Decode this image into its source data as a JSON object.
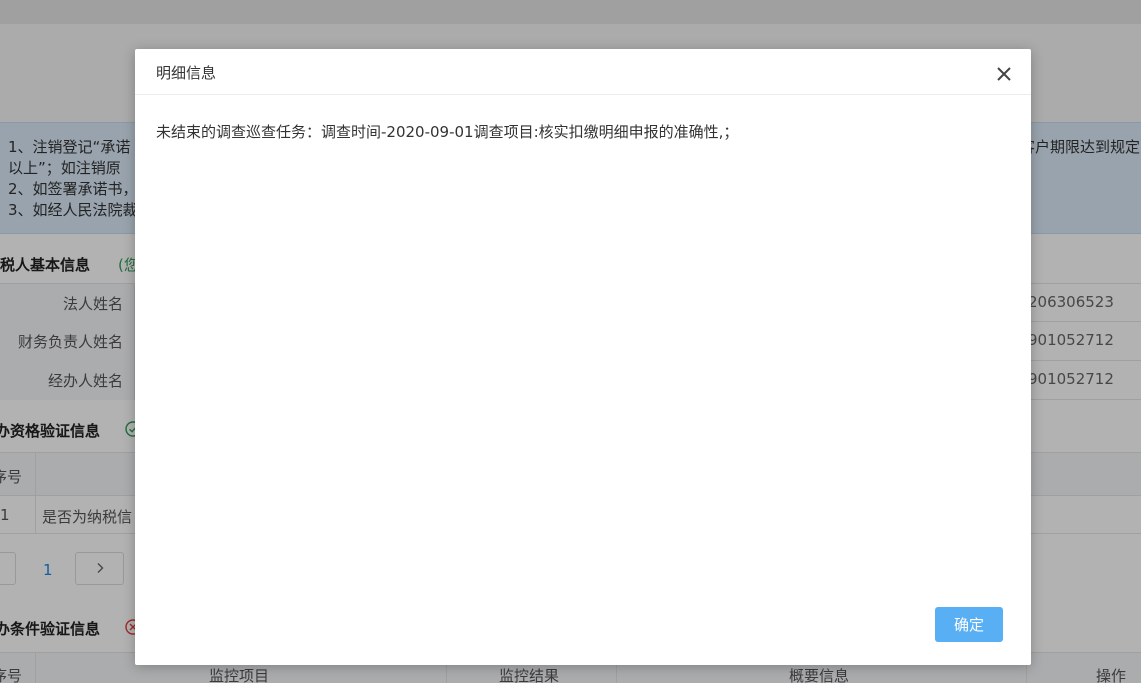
{
  "background": {
    "notice": {
      "line1_left": "1、注销登记“承诺",
      "line1_right": "客户期限达到规定",
      "line2": "以上”；如注销原",
      "line3": "2、如签署承诺书，",
      "line4": "3、如经人民法院裁"
    },
    "taxpayer_section": {
      "title": "纳税人基本信息",
      "note": "(您",
      "rows": [
        {
          "label": "法人姓名",
          "value": "206306523"
        },
        {
          "label": "财务负责人姓名",
          "value": "901052712"
        },
        {
          "label": "经办人姓名",
          "value": "901052712"
        }
      ]
    },
    "qualification_section": {
      "title": "办资格验证信息",
      "col_index": "序号",
      "row": {
        "index": "1",
        "text": "是否为纳税信"
      },
      "pager_page": "1"
    },
    "condition_section": {
      "title": "办条件验证信息",
      "columns": [
        "序号",
        "监控项目",
        "监控结果",
        "概要信息",
        "操作"
      ]
    }
  },
  "dialog": {
    "title": "明细信息",
    "body": "未结束的调查巡查任务：调查时间-2020-09-01调查项目:核实扣缴明细申报的准确性,；",
    "ok_label": "确定"
  }
}
